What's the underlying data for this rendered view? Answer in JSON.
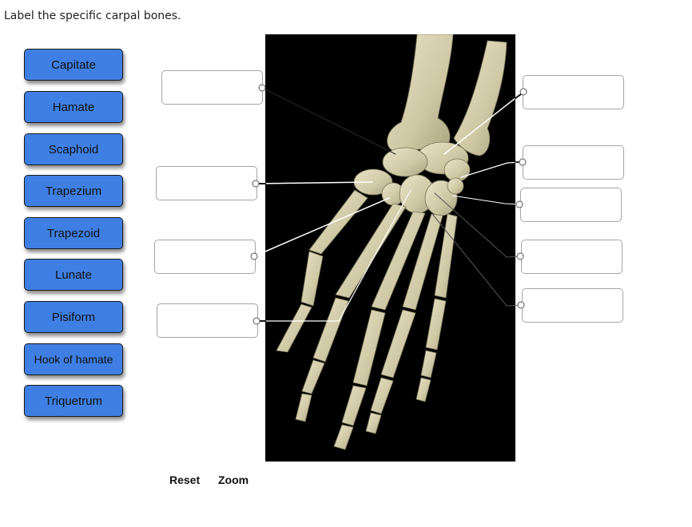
{
  "instruction": "Label the specific carpal bones.",
  "labels": [
    {
      "text": "Capitate"
    },
    {
      "text": "Hamate"
    },
    {
      "text": "Scaphoid"
    },
    {
      "text": "Trapezium"
    },
    {
      "text": "Trapezoid"
    },
    {
      "text": "Lunate"
    },
    {
      "text": "Pisiform"
    },
    {
      "text": "Hook of hamate"
    },
    {
      "text": "Triquetrum"
    }
  ],
  "drop_targets": [
    {
      "side": "left",
      "value": ""
    },
    {
      "side": "left",
      "value": ""
    },
    {
      "side": "left",
      "value": ""
    },
    {
      "side": "left",
      "value": ""
    },
    {
      "side": "right",
      "value": ""
    },
    {
      "side": "right",
      "value": ""
    },
    {
      "side": "right",
      "value": ""
    },
    {
      "side": "right",
      "value": ""
    },
    {
      "side": "right",
      "value": ""
    }
  ],
  "figure": {
    "subject": "hand-skeleton-dorsal-view",
    "background": "#000000",
    "bone_color": "#d8d2b2"
  },
  "controls": {
    "reset_label": "Reset",
    "zoom_label": "Zoom"
  },
  "colors": {
    "label_bg": "#3f7fe3",
    "label_border": "#1a1a1a",
    "drop_border": "#a5a5a5"
  }
}
